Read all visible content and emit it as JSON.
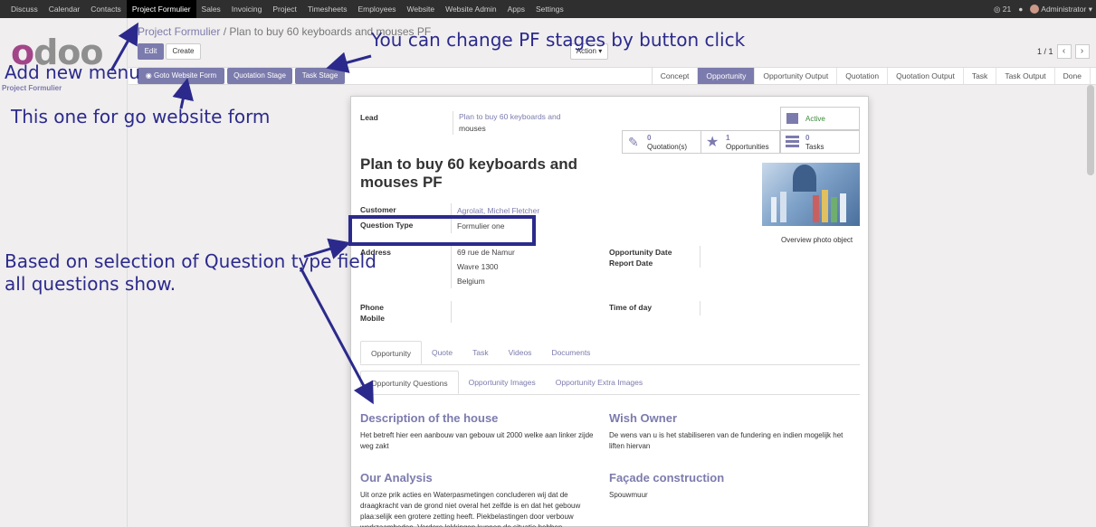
{
  "topbar": {
    "menu": [
      "Discuss",
      "Calendar",
      "Contacts",
      "Project Formulier",
      "Sales",
      "Invoicing",
      "Project",
      "Timesheets",
      "Employees",
      "Website",
      "Website Admin",
      "Apps",
      "Settings"
    ],
    "active_index": 3,
    "notification_count": "21",
    "user": "Administrator"
  },
  "left": {
    "logo": "odoo",
    "menu_label": "Project Formulier"
  },
  "breadcrumb": {
    "root": "Project Formulier",
    "separator": "/",
    "current": "Plan to buy 60 keyboards and mouses PF"
  },
  "buttons": {
    "edit": "Edit",
    "create": "Create",
    "action": "Action",
    "goto_website_form": "Goto Website Form",
    "quotation_stage": "Quotation Stage",
    "task_stage": "Task Stage"
  },
  "pager": {
    "text": "1 / 1",
    "prev": "‹",
    "next": "›"
  },
  "stages": {
    "items": [
      "Concept",
      "Opportunity",
      "Opportunity Output",
      "Quotation",
      "Quotation Output",
      "Task",
      "Task Output",
      "Done"
    ],
    "current_index": 1
  },
  "form": {
    "lead_label": "Lead",
    "lead_value_1": "Plan to buy 60 keyboards and",
    "lead_value_2": "mouses",
    "active": "Active",
    "smart": {
      "quotations_count": "0",
      "quotations_label": "Quotation(s)",
      "opportunities_count": "1",
      "opportunities_label": "Opportunities",
      "tasks_count": "0",
      "tasks_label": "Tasks"
    },
    "title": "Plan to buy 60 keyboards and mouses PF",
    "customer_label": "Customer",
    "customer_value": "Agrolait, Michel Fletcher",
    "question_type_label": "Question Type",
    "question_type_value": "Formulier one",
    "address_label": "Address",
    "address_line_1": "69 rue de Namur",
    "address_line_2": "Wavre 1300",
    "address_line_3": "Belgium",
    "opportunity_date_label": "Opportunity Date",
    "report_date_label": "Report Date",
    "phone_label": "Phone",
    "mobile_label": "Mobile",
    "time_of_day_label": "Time of day",
    "photo_caption": "Overview photo object"
  },
  "tabs": [
    "Opportunity",
    "Quote",
    "Task",
    "Videos",
    "Documents"
  ],
  "subtabs": [
    "Opportunity Questions",
    "Opportunity Images",
    "Opportunity Extra Images"
  ],
  "questions": {
    "q1_title": "Description of the house",
    "q1_text": "Het betreft hier een aanbouw van gebouw uit 2000 welke aan linker zijde weg zakt",
    "q2_title": "Wish Owner",
    "q2_text": "De wens van u is het stabiliseren van de fundering en indien mogelijk het liften hiervan",
    "q3_title": "Our Analysis",
    "q3_text": "Uit onze prik acties en Waterpasmetingen concluderen wij dat de draagkracht van de grond niet overal het zelfde is en dat het gebouw plaa:selijk een grotere zetting heeft. Piekbelastingen door verbouw werkzaamheden. Verdere lokkingen kunnen de situatie hebben",
    "q4_title": "Façade construction",
    "q4_text": "Spouwmuur"
  },
  "annotations": {
    "a1": "You can change PF stages by button click",
    "a2": "Add new menu",
    "a3": "This one for go website form",
    "a4_line1": "Based on selection of Question type field",
    "a4_line2": "all questions show."
  },
  "colors": {
    "brand": "#7c7bad",
    "annotation": "#2b2a8c",
    "topbar": "#2f2f2f"
  }
}
